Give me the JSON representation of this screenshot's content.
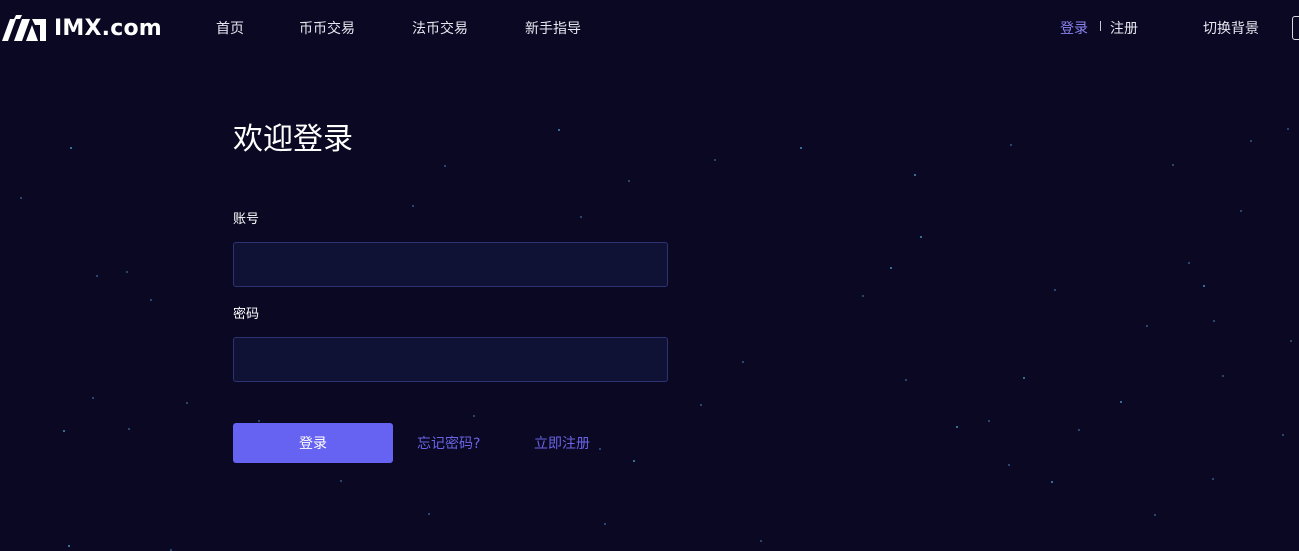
{
  "brand": {
    "name": "IMX.com",
    "logo_icon": "imx-logo-icon"
  },
  "nav": {
    "items": [
      {
        "label": "首页"
      },
      {
        "label": "币币交易"
      },
      {
        "label": "法币交易"
      },
      {
        "label": "新手指导"
      }
    ],
    "login": "登录",
    "register": "注册",
    "switch_background": "切换背景"
  },
  "form": {
    "title": "欢迎登录",
    "account_label": "账号",
    "account_value": "",
    "password_label": "密码",
    "password_value": "",
    "submit_label": "登录",
    "forgot_password": "忘记密码?",
    "register_now": "立即注册"
  },
  "colors": {
    "background": "#0a0822",
    "accent": "#6763f2",
    "link": "#6a64e6",
    "input_bg": "#101235",
    "input_border": "#2d3270"
  }
}
